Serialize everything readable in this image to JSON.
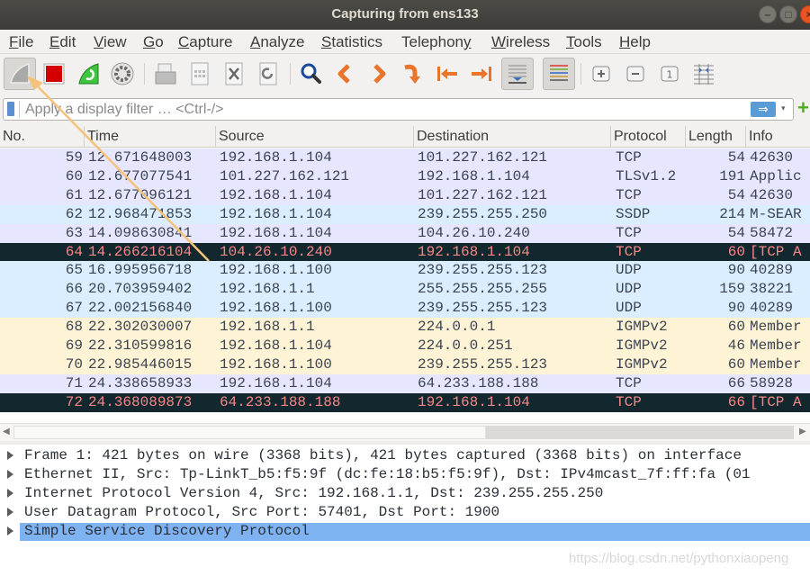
{
  "window": {
    "title": "Capturing from ens133",
    "controls": [
      "minimize",
      "maximize",
      "close"
    ]
  },
  "menubar": [
    {
      "label": "File",
      "mnemonic": "F"
    },
    {
      "label": "Edit",
      "mnemonic": "E"
    },
    {
      "label": "View",
      "mnemonic": "V"
    },
    {
      "label": "Go",
      "mnemonic": "G"
    },
    {
      "label": "Capture",
      "mnemonic": "C"
    },
    {
      "label": "Analyze",
      "mnemonic": "A"
    },
    {
      "label": "Statistics",
      "mnemonic": "S"
    },
    {
      "label": "Telephony",
      "mnemonic": "y"
    },
    {
      "label": "Wireless",
      "mnemonic": "W"
    },
    {
      "label": "Tools",
      "mnemonic": "T"
    },
    {
      "label": "Help",
      "mnemonic": "H"
    }
  ],
  "toolbar": {
    "buttons": [
      {
        "icon": "shark-fin-start-icon",
        "name": "start-capture"
      },
      {
        "icon": "stop-square-icon",
        "name": "stop-capture"
      },
      {
        "icon": "restart-fin-icon",
        "name": "restart-capture"
      },
      {
        "icon": "gear-icon",
        "name": "capture-options"
      },
      {
        "icon": "open-file-icon",
        "name": "open-file"
      },
      {
        "icon": "save-file-icon",
        "name": "save-file"
      },
      {
        "icon": "close-file-icon",
        "name": "close-file"
      },
      {
        "icon": "reload-icon",
        "name": "reload-file"
      },
      {
        "icon": "search-icon",
        "name": "find-packet"
      },
      {
        "icon": "chevron-left-icon",
        "name": "go-back"
      },
      {
        "icon": "chevron-right-icon",
        "name": "go-forward"
      },
      {
        "icon": "goto-packet-icon",
        "name": "go-to-packet"
      },
      {
        "icon": "first-packet-icon",
        "name": "go-first-packet"
      },
      {
        "icon": "last-packet-icon",
        "name": "go-last-packet"
      },
      {
        "icon": "autoscroll-icon",
        "name": "auto-scroll"
      },
      {
        "icon": "colorize-icon",
        "name": "colorize"
      },
      {
        "icon": "zoom-in-icon",
        "name": "zoom-in"
      },
      {
        "icon": "zoom-out-icon",
        "name": "zoom-out"
      },
      {
        "icon": "normal-size-icon",
        "name": "normal-size"
      },
      {
        "icon": "resize-columns-icon",
        "name": "resize-columns"
      }
    ]
  },
  "filter": {
    "placeholder": "Apply a display filter … <Ctrl-/>",
    "value": "",
    "apply_icon": "⇒",
    "dropdown_icon": "▾",
    "add_icon": "+"
  },
  "packet_list": {
    "columns": [
      "No.",
      "Time",
      "Source",
      "Destination",
      "Protocol",
      "Length",
      "Info"
    ],
    "rows": [
      {
        "no": "59",
        "time": "12.671648003",
        "src": "192.168.1.104",
        "dst": "101.227.162.121",
        "proto": "TCP",
        "len": "54",
        "info": "42630",
        "bg": "#e7e6ff",
        "fg": "#3b4450"
      },
      {
        "no": "60",
        "time": "12.677077541",
        "src": "101.227.162.121",
        "dst": "192.168.1.104",
        "proto": "TLSv1.2",
        "len": "191",
        "info": "Applic",
        "bg": "#e7e6ff",
        "fg": "#3b4450"
      },
      {
        "no": "61",
        "time": "12.677096121",
        "src": "192.168.1.104",
        "dst": "101.227.162.121",
        "proto": "TCP",
        "len": "54",
        "info": "42630",
        "bg": "#e7e6ff",
        "fg": "#3b4450"
      },
      {
        "no": "62",
        "time": "12.968471853",
        "src": "192.168.1.104",
        "dst": "239.255.255.250",
        "proto": "SSDP",
        "len": "214",
        "info": "M-SEAR",
        "bg": "#daeeff",
        "fg": "#3b4450"
      },
      {
        "no": "63",
        "time": "14.098630841",
        "src": "192.168.1.104",
        "dst": "104.26.10.240",
        "proto": "TCP",
        "len": "54",
        "info": "58472",
        "bg": "#e7e6ff",
        "fg": "#3b4450"
      },
      {
        "no": "64",
        "time": "14.266216104",
        "src": "104.26.10.240",
        "dst": "192.168.1.104",
        "proto": "TCP",
        "len": "60",
        "info": "[TCP A",
        "bg": "#12272e",
        "fg": "#f78787"
      },
      {
        "no": "65",
        "time": "16.995956718",
        "src": "192.168.1.100",
        "dst": "239.255.255.123",
        "proto": "UDP",
        "len": "90",
        "info": "40289",
        "bg": "#daeeff",
        "fg": "#3b4450"
      },
      {
        "no": "66",
        "time": "20.703959402",
        "src": "192.168.1.1",
        "dst": "255.255.255.255",
        "proto": "UDP",
        "len": "159",
        "info": "38221",
        "bg": "#daeeff",
        "fg": "#3b4450"
      },
      {
        "no": "67",
        "time": "22.002156840",
        "src": "192.168.1.100",
        "dst": "239.255.255.123",
        "proto": "UDP",
        "len": "90",
        "info": "40289",
        "bg": "#daeeff",
        "fg": "#3b4450"
      },
      {
        "no": "68",
        "time": "22.302030007",
        "src": "192.168.1.1",
        "dst": "224.0.0.1",
        "proto": "IGMPv2",
        "len": "60",
        "info": "Member",
        "bg": "#fff3d6",
        "fg": "#3b4450"
      },
      {
        "no": "69",
        "time": "22.310599816",
        "src": "192.168.1.104",
        "dst": "224.0.0.251",
        "proto": "IGMPv2",
        "len": "46",
        "info": "Member",
        "bg": "#fff3d6",
        "fg": "#3b4450"
      },
      {
        "no": "70",
        "time": "22.985446015",
        "src": "192.168.1.100",
        "dst": "239.255.255.123",
        "proto": "IGMPv2",
        "len": "60",
        "info": "Member",
        "bg": "#fff3d6",
        "fg": "#3b4450"
      },
      {
        "no": "71",
        "time": "24.338658933",
        "src": "192.168.1.104",
        "dst": "64.233.188.188",
        "proto": "TCP",
        "len": "66",
        "info": "58928",
        "bg": "#e7e6ff",
        "fg": "#3b4450"
      },
      {
        "no": "72",
        "time": "24.368089873",
        "src": "64.233.188.188",
        "dst": "192.168.1.104",
        "proto": "TCP",
        "len": "66",
        "info": "[TCP A",
        "bg": "#12272e",
        "fg": "#f78787"
      }
    ]
  },
  "details": {
    "items": [
      {
        "text": "Frame 1: 421 bytes on wire (3368 bits), 421 bytes captured (3368 bits) on interface",
        "selected": false
      },
      {
        "text": "Ethernet II, Src: Tp-LinkT_b5:f5:9f (dc:fe:18:b5:f5:9f), Dst: IPv4mcast_7f:ff:fa (01",
        "selected": false
      },
      {
        "text": "Internet Protocol Version 4, Src: 192.168.1.1, Dst: 239.255.255.250",
        "selected": false
      },
      {
        "text": "User Datagram Protocol, Src Port: 57401, Dst Port: 1900",
        "selected": false
      },
      {
        "text": "Simple Service Discovery Protocol",
        "selected": true
      }
    ]
  },
  "watermark": "https://blog.csdn.net/pythonxiaopeng",
  "colors": {
    "selection": "#7fb2f0",
    "titlebar": "#3c3b37",
    "close_button": "#e95420"
  }
}
